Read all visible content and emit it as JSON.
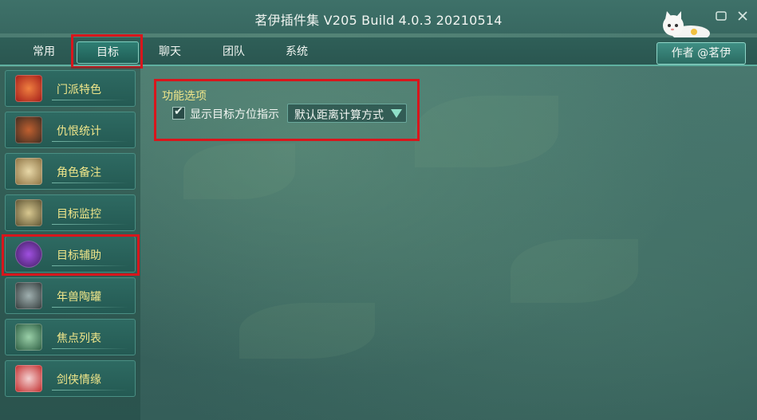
{
  "window": {
    "title": "茗伊插件集 V205 Build 4.0.3 20210514",
    "restore_icon": "window-restore-icon",
    "close_icon": "close-icon"
  },
  "tabs": [
    {
      "label": "常用",
      "active": false
    },
    {
      "label": "目标",
      "active": true
    },
    {
      "label": "聊天",
      "active": false
    },
    {
      "label": "团队",
      "active": false
    },
    {
      "label": "系统",
      "active": false
    }
  ],
  "author_button": "作者 @茗伊",
  "sidebar": {
    "items": [
      {
        "label": "门派特色",
        "icon": "dragon-icon",
        "color": "#c0392b"
      },
      {
        "label": "仇恨统计",
        "icon": "warrior-icon",
        "color": "#7a4a2a"
      },
      {
        "label": "角色备注",
        "icon": "book-icon",
        "color": "#b8a070"
      },
      {
        "label": "目标监控",
        "icon": "crest-icon",
        "color": "#8a7a40"
      },
      {
        "label": "目标辅助",
        "icon": "target-figure-icon",
        "color": "#5a2a8a",
        "selected": true
      },
      {
        "label": "年兽陶罐",
        "icon": "hammer-icon",
        "color": "#607070"
      },
      {
        "label": "焦点列表",
        "icon": "eye-icon",
        "color": "#3a7a5a"
      },
      {
        "label": "剑侠情缘",
        "icon": "heart-icon",
        "color": "#b02a2a"
      }
    ]
  },
  "main": {
    "section_title": "功能选项",
    "option": {
      "checked": true,
      "label": "显示目标方位指示",
      "dropdown_value": "默认距离计算方式"
    }
  },
  "colors": {
    "highlight_red": "#d8161c",
    "label_yellow": "#f0e68a",
    "accent_teal": "#5fb0a0"
  }
}
